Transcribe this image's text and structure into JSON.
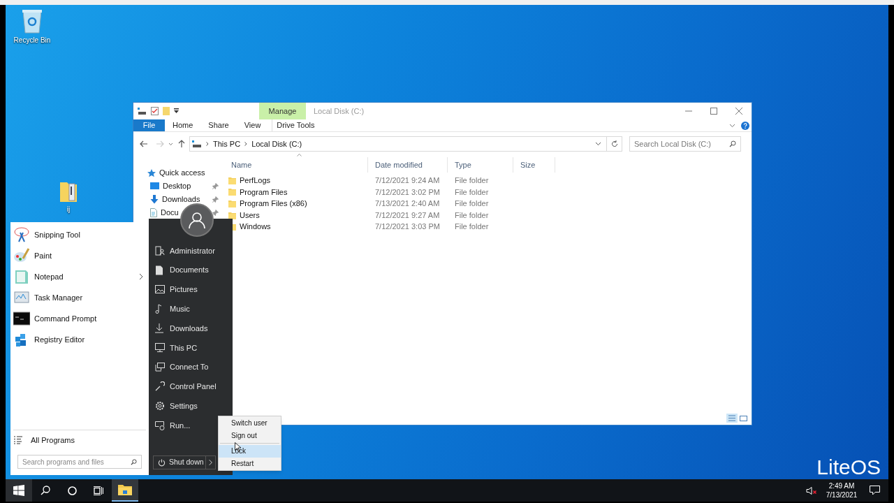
{
  "desktop": {
    "icons": [
      {
        "label": "Recycle Bin",
        "kind": "recycle"
      },
      {
        "label": "ij",
        "kind": "folder"
      }
    ],
    "branding": "LiteOS"
  },
  "explorer": {
    "title": "Local Disk (C:)",
    "context_header": "Manage",
    "ribbon_tabs": [
      {
        "label": "File",
        "kind": "file"
      },
      {
        "label": "Home",
        "kind": "tab"
      },
      {
        "label": "Share",
        "kind": "tab"
      },
      {
        "label": "View",
        "kind": "tab"
      },
      {
        "label": "Drive Tools",
        "kind": "context"
      }
    ],
    "breadcrumb": [
      "This PC",
      "Local Disk (C:)"
    ],
    "search": {
      "placeholder": "Search Local Disk (C:)"
    },
    "nav": [
      {
        "label": "Quick access",
        "kind": "star",
        "pinned": false
      },
      {
        "label": "Desktop",
        "kind": "desktop",
        "pinned": true
      },
      {
        "label": "Downloads",
        "kind": "download",
        "pinned": true
      },
      {
        "label": "Docu",
        "kind": "document",
        "pinned": true
      }
    ],
    "columns": [
      "Name",
      "Date modified",
      "Type",
      "Size"
    ],
    "rows": [
      {
        "name": "PerfLogs",
        "date": "7/12/2021 9:24 AM",
        "type": "File folder"
      },
      {
        "name": "Program Files",
        "date": "7/12/2021 3:02 PM",
        "type": "File folder"
      },
      {
        "name": "Program Files (x86)",
        "date": "7/13/2021 2:40 AM",
        "type": "File folder"
      },
      {
        "name": "Users",
        "date": "7/12/2021 9:27 AM",
        "type": "File folder"
      },
      {
        "name": "Windows",
        "date": "7/12/2021 3:03 PM",
        "type": "File folder"
      }
    ]
  },
  "start_menu": {
    "programs": [
      {
        "label": "Snipping Tool",
        "kind": "snip",
        "has_submenu": false
      },
      {
        "label": "Paint",
        "kind": "paint",
        "has_submenu": false
      },
      {
        "label": "Notepad",
        "kind": "notepad",
        "has_submenu": true
      },
      {
        "label": "Task Manager",
        "kind": "taskmgr",
        "has_submenu": false
      },
      {
        "label": "Command Prompt",
        "kind": "cmd",
        "has_submenu": false
      },
      {
        "label": "Registry Editor",
        "kind": "regedit",
        "has_submenu": false
      }
    ],
    "all_programs": "All Programs",
    "search": {
      "placeholder": "Search programs and files"
    },
    "places": [
      {
        "label": "Administrator",
        "kind": "user"
      },
      {
        "label": "Documents",
        "kind": "document"
      },
      {
        "label": "Pictures",
        "kind": "picture"
      },
      {
        "label": "Music",
        "kind": "music"
      },
      {
        "label": "Downloads",
        "kind": "download"
      },
      {
        "label": "This PC",
        "kind": "pc"
      },
      {
        "label": "Connect To",
        "kind": "network"
      },
      {
        "label": "Control Panel",
        "kind": "wrench"
      },
      {
        "label": "Settings",
        "kind": "gear"
      },
      {
        "label": "Run...",
        "kind": "run"
      }
    ],
    "shutdown": "Shut down"
  },
  "power_menu": [
    {
      "label": "Switch user",
      "selected": false,
      "separator_above": false
    },
    {
      "label": "Sign out",
      "selected": false,
      "separator_above": false
    },
    {
      "label": "Lock",
      "selected": true,
      "separator_above": true
    },
    {
      "label": "Restart",
      "selected": false,
      "separator_above": false
    }
  ],
  "taskbar": {
    "apps": [
      {
        "kind": "explorer",
        "selected": true
      }
    ],
    "time": "2:49 AM",
    "date": "7/13/2021",
    "muted": true
  }
}
